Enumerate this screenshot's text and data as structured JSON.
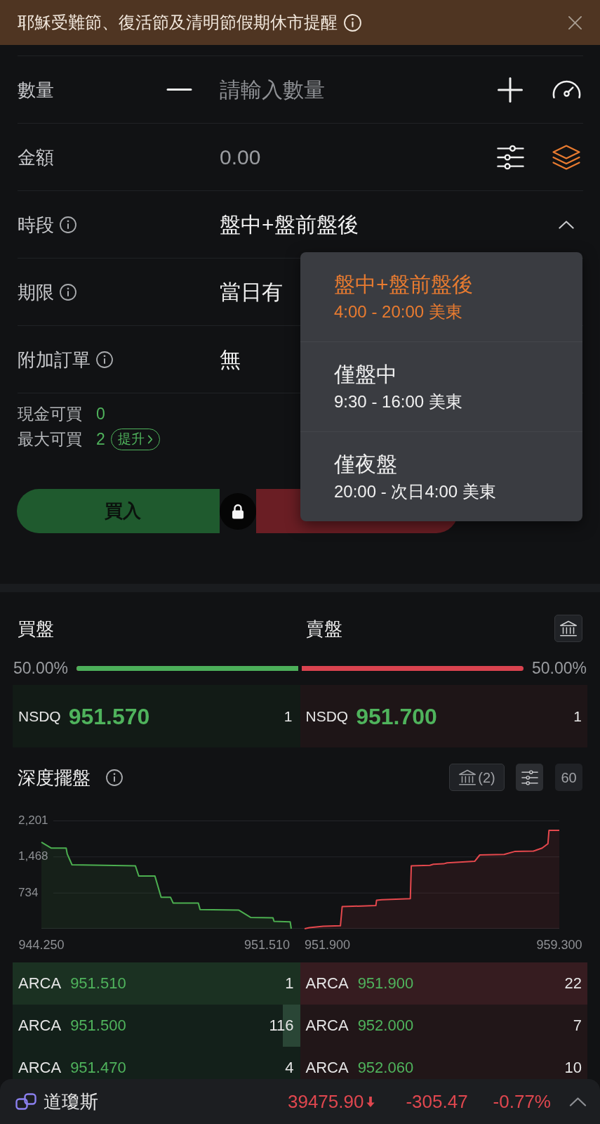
{
  "banner": {
    "text": "耶穌受難節、復活節及清明節假期休市提醒"
  },
  "order_form": {
    "rows": [
      {
        "kind": "quantity",
        "label": "數量",
        "placeholder": "請輸入數量"
      },
      {
        "kind": "amount",
        "label": "金額",
        "value": "0.00"
      },
      {
        "kind": "select",
        "label": "時段",
        "value": "盤中+盤前盤後",
        "expanded": true
      },
      {
        "kind": "select",
        "label": "期限",
        "value": "當日有"
      },
      {
        "kind": "select",
        "label": "附加訂單",
        "value": "無"
      }
    ]
  },
  "session_menu": {
    "options": [
      {
        "title": "盤中+盤前盤後",
        "hours": "4:00 - 20:00 美東",
        "selected": true
      },
      {
        "title": "僅盤中",
        "hours": "9:30 - 16:00 美東",
        "selected": false
      },
      {
        "title": "僅夜盤",
        "hours": "20:00 - 次日4:00 美東",
        "selected": false
      }
    ]
  },
  "buying_power": [
    {
      "label": "現金可買",
      "value": "0"
    },
    {
      "label": "最大可買",
      "value": "2",
      "action": "提升"
    }
  ],
  "trade_buttons": [
    {
      "kind": "buy",
      "label": "買入"
    },
    {
      "kind": "sell"
    }
  ],
  "quote": {
    "bid_title": "買盤",
    "ask_title": "賣盤",
    "bid_share": "50.00%",
    "ask_share": "50.00%",
    "level": 0.5,
    "best_bid": {
      "exchange": "NSDQ",
      "price": "951.570",
      "size": "1"
    },
    "best_ask": {
      "exchange": "NSDQ",
      "price": "951.700",
      "size": "1"
    }
  },
  "depth": {
    "title": "深度擺盤",
    "exchange_count": "(2)",
    "rows_shown": "60",
    "chart_data": {
      "type": "area",
      "x": [
        944.25,
        944.54,
        944.97,
        945.0,
        945.14,
        946.98,
        947.08,
        947.55,
        947.73,
        948.0,
        948.08,
        948.81,
        948.86,
        949.98,
        950.33,
        950.98,
        951.01,
        951.48,
        951.51,
        951.9,
        952.04,
        952.44,
        952.94,
        952.99,
        953.97,
        953.99,
        954.14,
        954.97,
        955.0,
        955.54,
        955.64,
        955.94,
        956.04,
        956.84,
        956.99,
        957.7,
        958.0,
        958.55,
        958.8,
        958.97,
        959.0,
        959.3
      ],
      "series": [
        {
          "color": "#4caf50",
          "values": [
            1760,
            1640,
            1640,
            1520,
            1300,
            1280,
            1070,
            1070,
            640,
            640,
            520,
            520,
            390,
            380,
            230,
            220,
            150,
            140,
            0,
            null,
            null,
            null,
            null,
            null,
            null,
            null,
            null,
            null,
            null,
            null,
            null,
            null,
            null,
            null,
            null,
            null,
            null,
            null,
            null,
            null,
            null,
            null
          ]
        },
        {
          "color": "#e5484d",
          "values": [
            null,
            null,
            null,
            null,
            null,
            null,
            null,
            null,
            null,
            null,
            null,
            null,
            null,
            null,
            null,
            null,
            null,
            null,
            null,
            0,
            20,
            50,
            60,
            450,
            470,
            580,
            590,
            610,
            1280,
            1290,
            1310,
            1320,
            1340,
            1370,
            1500,
            1510,
            1570,
            1580,
            1640,
            1730,
            2000,
            2000
          ]
        }
      ],
      "xlim": [
        944.25,
        959.3
      ],
      "ylim": [
        0,
        2201
      ],
      "xticks": [
        {
          "value": 944.25,
          "label": "944.250"
        },
        {
          "value": 959.3,
          "label": "959.300"
        }
      ],
      "yticks": [
        {
          "value": 734,
          "label": "734"
        },
        {
          "value": 1468,
          "label": "1,468"
        },
        {
          "value": 2201,
          "label": "2,201"
        }
      ],
      "grid": true
    },
    "bid_edge_price": "951.510",
    "ask_edge_price": "951.900",
    "bids": [
      {
        "exchange": "ARCA",
        "price": "951.510",
        "size": "1",
        "highlighted": true
      },
      {
        "exchange": "ARCA",
        "price": "951.500",
        "size": "116",
        "highlighted": false,
        "level": 0.06
      },
      {
        "exchange": "ARCA",
        "price": "951.470",
        "size": "4",
        "highlighted": false
      }
    ],
    "asks": [
      {
        "exchange": "ARCA",
        "price": "951.900",
        "size": "22",
        "highlighted": true
      },
      {
        "exchange": "ARCA",
        "price": "952.000",
        "size": "7",
        "highlighted": false
      },
      {
        "exchange": "ARCA",
        "price": "952.060",
        "size": "10",
        "highlighted": false
      }
    ]
  },
  "ticker": {
    "name": "道瓊斯",
    "price": "39475.90",
    "down": true,
    "change": "-305.47",
    "change_percent": "-0.77%"
  }
}
